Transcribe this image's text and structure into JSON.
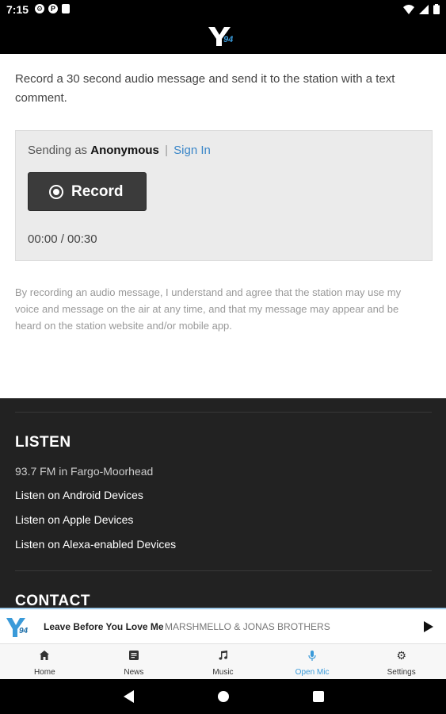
{
  "status_bar": {
    "time": "7:15",
    "app_icon_letter": "P"
  },
  "header": {
    "logo_text": "Y94",
    "logo_color": "#3a9ad9"
  },
  "open_mic": {
    "intro": "Record a 30 second audio message and send it to the station with a text comment.",
    "sending_prefix": "Sending as",
    "sending_user": "Anonymous",
    "separator": "|",
    "sign_in": "Sign In",
    "record_label": "Record",
    "timer": "00:00 / 00:30",
    "disclaimer": "By recording an audio message, I understand and agree that the station may use my voice and message on the air at any time, and that my message may appear and be heard on the station website and/or mobile app."
  },
  "footer": {
    "listen_heading": "LISTEN",
    "frequency": "93.7 FM in Fargo-Moorhead",
    "links": [
      "Listen on Android Devices",
      "Listen on Apple Devices",
      "Listen on Alexa-enabled Devices"
    ],
    "contact_heading": "CONTACT"
  },
  "now_playing": {
    "title": "Leave Before You Love Me",
    "artist": "MARSHMELLO & JONAS BROTHERS"
  },
  "tabs": [
    {
      "label": "Home",
      "icon": "home-icon"
    },
    {
      "label": "News",
      "icon": "news-icon"
    },
    {
      "label": "Music",
      "icon": "music-note-icon"
    },
    {
      "label": "Open Mic",
      "icon": "microphone-icon",
      "active": true
    },
    {
      "label": "Settings",
      "icon": "gear-icon"
    }
  ],
  "colors": {
    "accent": "#3a9ad9",
    "footer_bg": "#222222",
    "link": "#3a86c8"
  }
}
